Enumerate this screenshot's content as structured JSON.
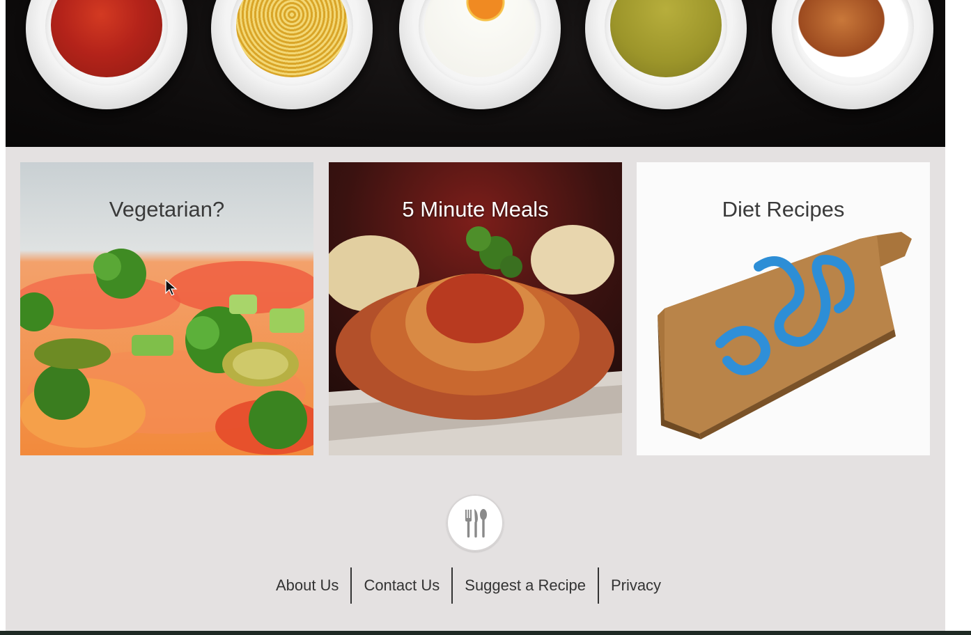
{
  "hero": {
    "plates": [
      {
        "name": "tomato-soup",
        "food_color": "#b4231a",
        "accent": "#e8b46a"
      },
      {
        "name": "spaghetti",
        "food_color": "#e3b53a",
        "accent": "#f3d774"
      },
      {
        "name": "fried-egg",
        "food_color": "#fbfbf6",
        "accent": "#f08a22"
      },
      {
        "name": "pea-soup",
        "food_color": "#9c952a",
        "accent": "#c0b74c"
      },
      {
        "name": "croissants",
        "food_color": "#9c4a1f",
        "accent": "#c9783a"
      }
    ]
  },
  "categories": [
    {
      "title": "Vegetarian?",
      "image": "vegetable-pizza-photo"
    },
    {
      "title": "5 Minute Meals",
      "image": "spaghetti-photo"
    },
    {
      "title": "Diet Recipes",
      "image": "cutting-board-measuring-tape-photo"
    }
  ],
  "footer": {
    "logo_icon": "cutlery-icon",
    "links": [
      "About Us",
      "Contact Us",
      "Suggest a Recipe",
      "Privacy"
    ]
  },
  "colors": {
    "page_bg": "#e4e1e1",
    "hero_bg": "#0d0b0b",
    "text": "#333333"
  }
}
